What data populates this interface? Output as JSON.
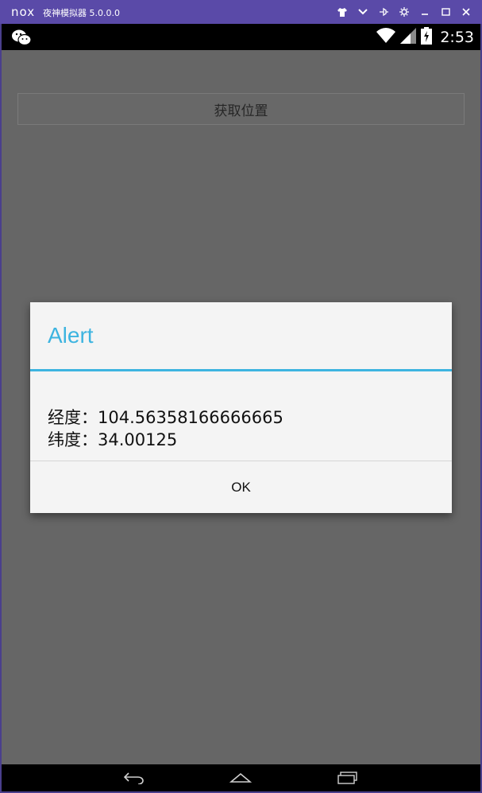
{
  "emulator": {
    "logo": "nox",
    "title": "夜神模拟器 5.0.0.0",
    "controls": [
      "shirt-icon",
      "chevron-down-icon",
      "pin-icon",
      "gear-icon",
      "minimize-icon",
      "maximize-icon",
      "close-icon"
    ]
  },
  "statusbar": {
    "app_icon": "wechat-icon",
    "wifi_icon": "wifi-icon",
    "signal_icon": "signal-icon",
    "battery_icon": "battery-icon",
    "time": "2:53"
  },
  "app": {
    "get_location_label": "获取位置"
  },
  "dialog": {
    "title": "Alert",
    "message_lines": [
      "经度：104.56358166666665",
      "纬度：34.00125"
    ],
    "ok_label": "OK",
    "accent_color": "#3db4e0"
  },
  "navbar": {
    "back_icon": "back-icon",
    "home_icon": "home-icon",
    "recents_icon": "recents-icon"
  }
}
